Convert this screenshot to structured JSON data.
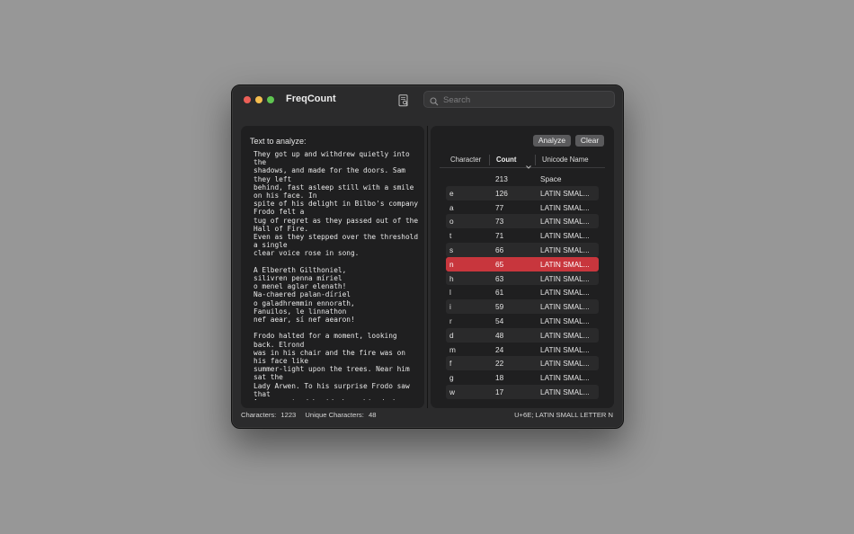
{
  "window": {
    "title": "FreqCount"
  },
  "toolbar": {
    "doc_icon": "document-magnifier-icon"
  },
  "search": {
    "placeholder": "Search",
    "value": ""
  },
  "input_pane": {
    "label": "Text to analyze:",
    "text": "They got up and withdrew quietly into the\nshadows, and made for the doors. Sam they left\nbehind, fast asleep still with a smile on his face. In\nspite of his delight in Bilbo's company Frodo felt a\ntug of regret as they passed out of the Hall of Fire.\nEven as they stepped over the threshold a single\nclear voice rose in song.\n\nA Elbereth Gilthoniel,\nsilivren penna míriel\no menel aglar elenath!\nNa-chaered palan-díriel\no galadhremmin ennorath,\nFanuilos, le linnathon\nnef aear, sí nef aearon!\n\nFrodo halted for a moment, looking back. Elrond\nwas in his chair and the fire was on his face like\nsummer-light upon the trees. Near him sat the\nLady Arwen. To his surprise Frodo saw that\nAragorn stood beside her; his dark cloak was\nthrown back, and he seemed to be clad in elven-\nmail, and a star shone on his breast. They spoke\ntogether, and then suddenly it seemed to Frodo\nthat Arwen turned towards him, and the light of\nher eyes fell on him from afar and pierced his\nheart.\n\nHe stood still enchanted, while the sweet syllables\nof the elvish song fell like clear jewels of blended"
  },
  "actions": {
    "analyze_label": "Analyze",
    "clear_label": "Clear"
  },
  "table": {
    "columns": {
      "character": "Character",
      "count": "Count",
      "name": "Unicode Name"
    },
    "selected_index": 6,
    "rows": [
      {
        "ch": "",
        "count": "213",
        "name": "Space"
      },
      {
        "ch": "e",
        "count": "126",
        "name": "LATIN SMAL..."
      },
      {
        "ch": "a",
        "count": "77",
        "name": "LATIN SMAL..."
      },
      {
        "ch": "o",
        "count": "73",
        "name": "LATIN SMAL..."
      },
      {
        "ch": "t",
        "count": "71",
        "name": "LATIN SMAL..."
      },
      {
        "ch": "s",
        "count": "66",
        "name": "LATIN SMAL..."
      },
      {
        "ch": "n",
        "count": "65",
        "name": "LATIN SMAL..."
      },
      {
        "ch": "h",
        "count": "63",
        "name": "LATIN SMAL..."
      },
      {
        "ch": "l",
        "count": "61",
        "name": "LATIN SMAL..."
      },
      {
        "ch": "i",
        "count": "59",
        "name": "LATIN SMAL..."
      },
      {
        "ch": "r",
        "count": "54",
        "name": "LATIN SMAL..."
      },
      {
        "ch": "d",
        "count": "48",
        "name": "LATIN SMAL..."
      },
      {
        "ch": "m",
        "count": "24",
        "name": "LATIN SMAL..."
      },
      {
        "ch": "f",
        "count": "22",
        "name": "LATIN SMAL..."
      },
      {
        "ch": "g",
        "count": "18",
        "name": "LATIN SMAL..."
      },
      {
        "ch": "w",
        "count": "17",
        "name": "LATIN SMAL..."
      }
    ]
  },
  "status": {
    "characters_label": "Characters:",
    "characters_value": "1223",
    "unique_label": "Unique Characters:",
    "unique_value": "48",
    "selection_info": "U+6E; LATIN SMALL LETTER N"
  },
  "colors": {
    "selection": "#c8363d",
    "close": "#ec5f57",
    "minimize": "#f4bd4f",
    "zoom": "#5fc551"
  }
}
